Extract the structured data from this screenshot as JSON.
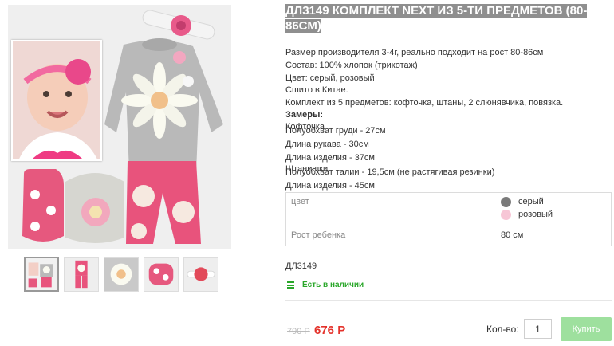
{
  "product": {
    "title": "ДЛ3149 КОМПЛЕКТ NEXT ИЗ 5-ТИ ПРЕДМЕТОВ (80-86СМ)",
    "description": [
      "Размер производителя 3-4г, реально подходит на рост 80-86см",
      "Состав: 100% хлопок (трикотаж)",
      "Цвет: серый, розовый",
      "Сшито в Китае.",
      "Комплект из 5 предметов: кофточка, штаны, 2 слюнявчика, повязка."
    ],
    "measurements": {
      "heading": "Замеры:",
      "jacket_heading": "Кофточка",
      "jacket_lines": [
        "Полуобхват груди - 27см",
        "Длина рукава - 30см",
        "Длина изделия - 37см"
      ],
      "pants_heading": "Штанишки",
      "pants_lines": [
        "Полуобхват талии - 19,5см (не растягивая резинки)",
        "Длина изделия - 45см"
      ]
    },
    "options": {
      "color_label": "цвет",
      "colors": [
        {
          "name": "серый",
          "hex": "#7a7a7a"
        },
        {
          "name": "розовый",
          "hex": "#f7c6d6"
        }
      ],
      "height_label": "Рост ребенка",
      "height_value": "80 см"
    },
    "sku": "ДЛ3149",
    "stock": "Есть в наличии",
    "old_price": "790 Р",
    "price": "676 Р",
    "qty_label": "Кол-во:",
    "qty_value": "1",
    "buy_label": "Купить"
  },
  "gallery": {
    "thumbnails": [
      "thumb-1",
      "thumb-2",
      "thumb-3",
      "thumb-4",
      "thumb-5"
    ],
    "active_index": 0
  },
  "colors": {
    "price_red": "#e4322b",
    "stock_green": "#2aa72a",
    "buy_button": "#9ee09e",
    "title_highlight": "#8f8f8f"
  }
}
